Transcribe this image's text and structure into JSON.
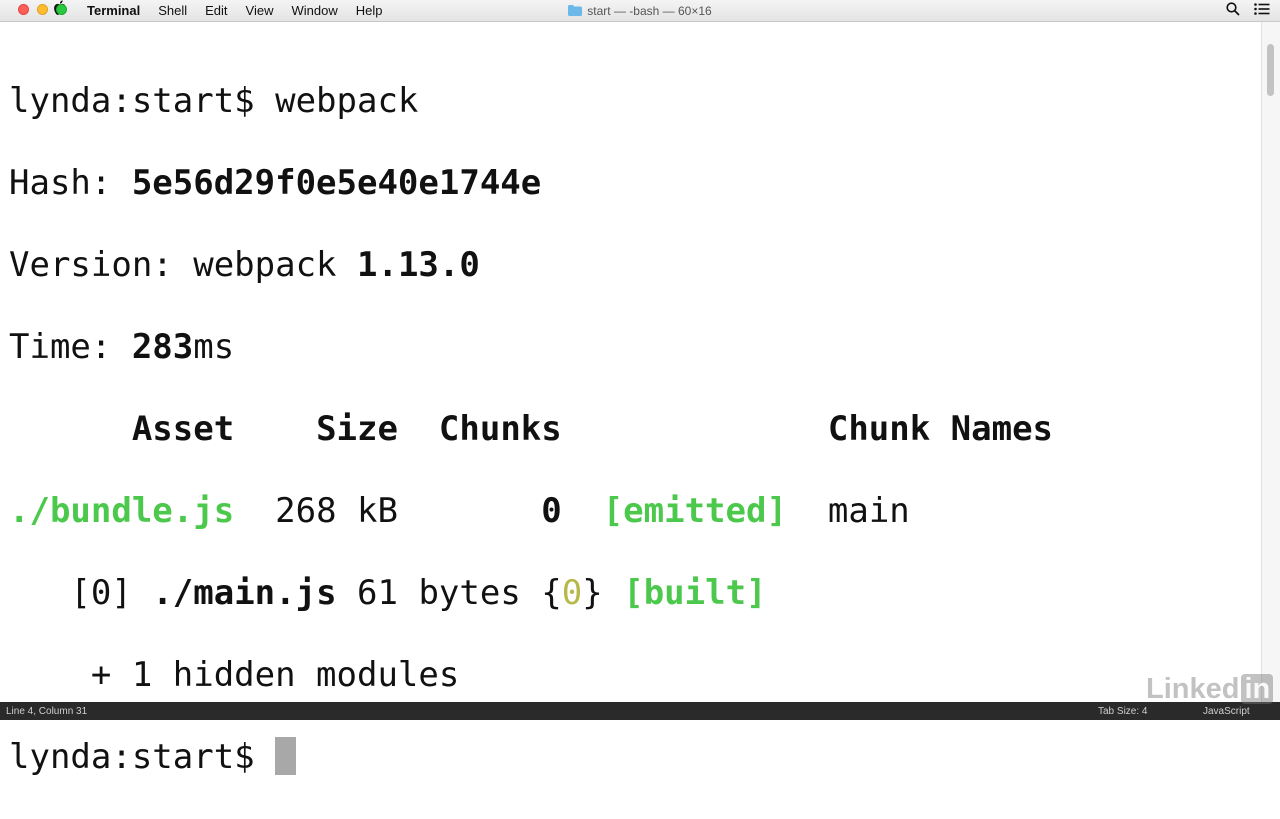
{
  "menubar": {
    "app_name": "Terminal",
    "items": [
      "Shell",
      "Edit",
      "View",
      "Window",
      "Help"
    ],
    "window_title": "start — -bash — 60×16"
  },
  "terminal": {
    "prompt": "lynda:start$ ",
    "command": "webpack",
    "hash_label": "Hash: ",
    "hash_value": "5e56d29f0e5e40e1744e",
    "version_label": "Version: webpack ",
    "version_value": "1.13.0",
    "time_label": "Time: ",
    "time_value": "283",
    "time_unit": "ms",
    "table_header": {
      "asset": "Asset",
      "size": "Size",
      "chunks": "Chunks",
      "chunk_names": "Chunk Names"
    },
    "asset_row": {
      "asset": "./bundle.js",
      "size": "268 kB",
      "chunk": "0",
      "status": "[emitted]",
      "chunk_name": "main"
    },
    "module_row": {
      "index": "[0]",
      "file": "./main.js",
      "size": "61 bytes",
      "brace_open": "{",
      "chunk": "0",
      "brace_close": "}",
      "status": "[built]"
    },
    "hidden_modules": "+ 1 hidden modules",
    "final_prompt": "lynda:start$ "
  },
  "statusbar": {
    "position": "Line 4, Column 31",
    "tab_size": "Tab Size: 4",
    "syntax": "JavaScript"
  },
  "watermark": {
    "text": "Linked",
    "badge": "in"
  },
  "colors": {
    "green": "#4cc94c",
    "yellow": "#b8b84a",
    "cursor": "#a8a8a8"
  }
}
